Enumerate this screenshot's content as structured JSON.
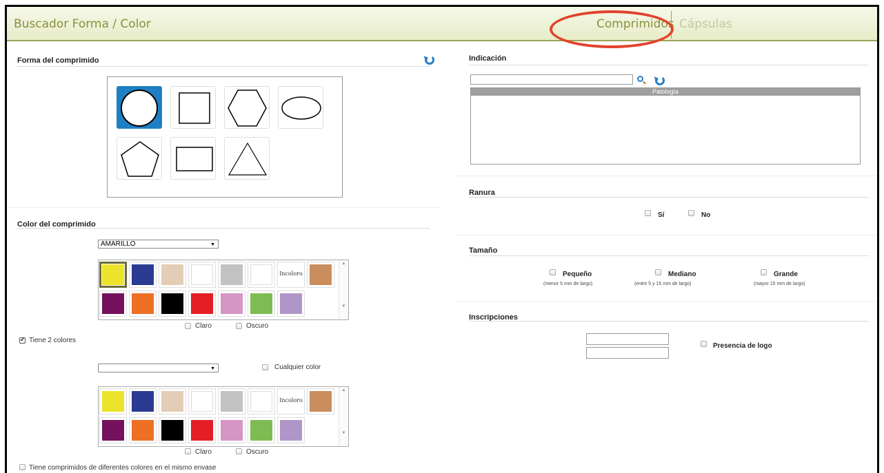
{
  "header": {
    "title": "Buscador Forma / Color",
    "tabs": [
      {
        "label": "Comprimidos",
        "active": true
      },
      {
        "label": "Cápsulas",
        "active": false
      }
    ]
  },
  "forma": {
    "title": "Forma del comprimido",
    "shapes": [
      "circle",
      "square",
      "hexagon",
      "ellipse",
      "pentagon",
      "rectangle",
      "triangle"
    ],
    "selected": "circle"
  },
  "color": {
    "title": "Color del comprimido",
    "select1_value": "AMARILLO",
    "select2_value": "",
    "colorless_label": "Incoloro",
    "swatches": [
      "#ece32b",
      "#2a3b91",
      "#e3cdb5",
      "#ffffff",
      "#c2c2c2",
      "#ffffff",
      "incoloro",
      "#c98d5e",
      "#74115c",
      "#ee7024",
      "#000000",
      "#e41e24",
      "#d595c5",
      "#7fbb53",
      "#b095c8"
    ],
    "claro_label": "Claro",
    "oscuro_label": "Oscuro",
    "two_colors_label": "Tiene 2 colores",
    "any_color_label": "Cualquier color",
    "different_colors_label": "Tiene comprimidos de diferentes colores en el mismo envase"
  },
  "indicacion": {
    "title": "Indicación",
    "search_value": "",
    "patologia_header": "Patología"
  },
  "ranura": {
    "title": "Ranura",
    "si_label": "Sí",
    "no_label": "No"
  },
  "tamano": {
    "title": "Tamaño",
    "options": [
      {
        "label": "Pequeño",
        "hint": "(menor 5 mm de largo)"
      },
      {
        "label": "Mediano",
        "hint": "(entre 5 y 15 mm de largo)"
      },
      {
        "label": "Grande",
        "hint": "(mayor 15 mm de largo)"
      }
    ]
  },
  "inscripciones": {
    "title": "Inscripciones",
    "input1": "",
    "input2": "",
    "logo_label": "Presencia de logo"
  },
  "colors": {
    "accent": "#8a8f3c",
    "selected_shape": "#1f7fc4",
    "highlight_ring": "#e2422b"
  }
}
